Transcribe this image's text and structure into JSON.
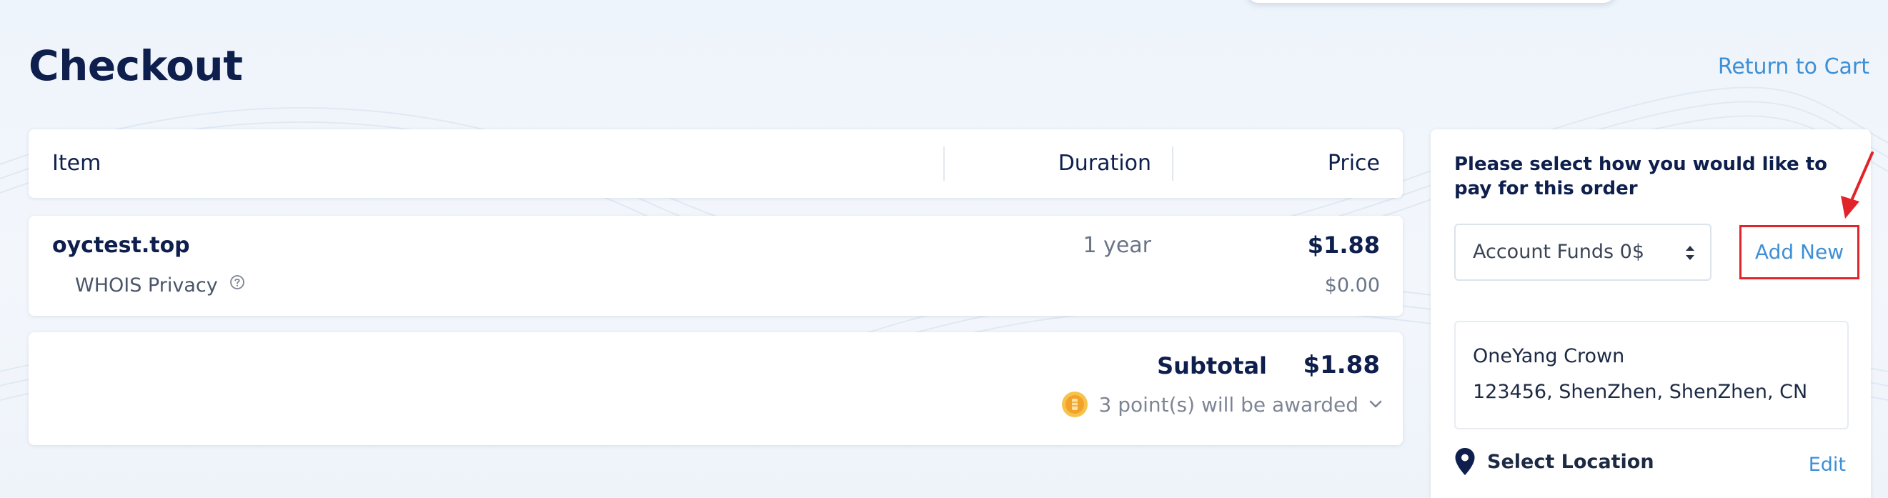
{
  "page": {
    "title": "Checkout",
    "return_link": "Return to Cart"
  },
  "table": {
    "headers": {
      "item": "Item",
      "duration": "Duration",
      "price": "Price"
    },
    "rows": [
      {
        "domain": "oyctest.top",
        "duration": "1 year",
        "price": "$1.88",
        "addon": {
          "label": "WHOIS Privacy",
          "price": "$0.00"
        }
      }
    ]
  },
  "summary": {
    "subtotal_label": "Subtotal",
    "subtotal_value": "$1.88",
    "points_text": "3 point(s) will be awarded"
  },
  "payment": {
    "heading": "Please select how you would like to pay for this order",
    "selected_method": "Account Funds 0$",
    "add_new_label": "Add New",
    "address": {
      "name": "OneYang Crown",
      "line": "123456, ShenZhen, ShenZhen, CN"
    },
    "select_location_label": "Select Location",
    "edit_label": "Edit"
  },
  "colors": {
    "title": "#0e1f4d",
    "link": "#3d8fd6",
    "highlight_border": "#e0242a",
    "coin": "#f2a22b"
  },
  "icons": [
    "help-icon",
    "chevron-down-icon",
    "coin-icon",
    "select-caret-icon",
    "location-pin-icon",
    "annotation-arrow-icon"
  ]
}
